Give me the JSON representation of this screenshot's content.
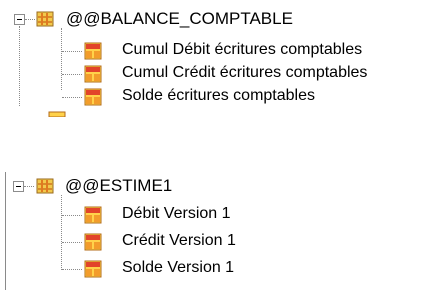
{
  "tree": {
    "groups": [
      {
        "name": "@@BALANCE_COMPTABLE",
        "icon": "cube-icon",
        "expanded": true,
        "items": [
          {
            "label": "Cumul Débit écritures comptables",
            "icon": "measure-icon"
          },
          {
            "label": "Cumul Crédit écritures comptables",
            "icon": "measure-icon"
          },
          {
            "label": "Solde écritures comptables",
            "icon": "measure-icon"
          }
        ]
      },
      {
        "name": "@@ESTIME1",
        "icon": "cube-icon",
        "expanded": true,
        "items": [
          {
            "label": "Débit Version 1",
            "icon": "measure-icon"
          },
          {
            "label": "Crédit Version 1",
            "icon": "measure-icon"
          },
          {
            "label": "Solde Version 1",
            "icon": "measure-icon"
          }
        ]
      }
    ]
  },
  "colors": {
    "cube_orange": "#d98a2b",
    "cube_yellow": "#f2c94c",
    "measure_red": "#e2442a",
    "measure_yellow": "#ffd24a",
    "tree_line": "#8a8a8a"
  }
}
